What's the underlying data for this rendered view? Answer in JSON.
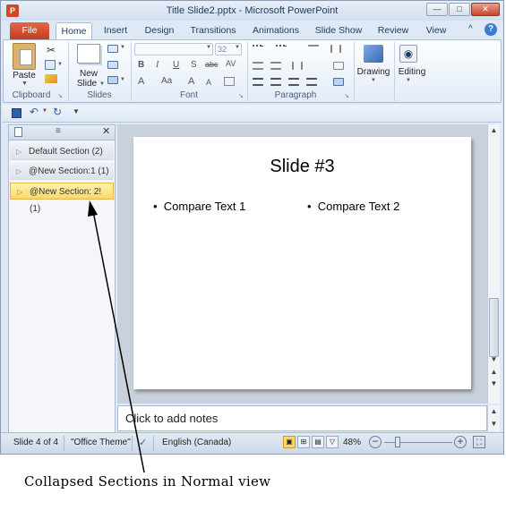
{
  "window": {
    "title": "Title Slide2.pptx - Microsoft PowerPoint",
    "app_icon": "P",
    "minimize_glyph": "—",
    "maximize_glyph": "□",
    "close_glyph": "✕"
  },
  "tabs": {
    "file": "File",
    "items": [
      "Home",
      "Insert",
      "Design",
      "Transitions",
      "Animations",
      "Slide Show",
      "Review",
      "View"
    ]
  },
  "ribbon": {
    "clipboard": {
      "paste": "Paste",
      "label": "Clipboard"
    },
    "slides": {
      "new_slide": "New",
      "new_slide_2": "Slide",
      "label": "Slides"
    },
    "font": {
      "size": "32",
      "label": "Font",
      "bold": "B",
      "italic": "I",
      "underline": "U",
      "shadow": "S",
      "strike": "abc",
      "spacing": "AV",
      "color": "A",
      "case": "Aa",
      "grow": "A",
      "shrink": "A"
    },
    "paragraph": {
      "label": "Paragraph"
    },
    "drawing": {
      "label": "Drawing"
    },
    "editing": {
      "label": "Editing"
    }
  },
  "sections": [
    {
      "label": "Default Section (2)"
    },
    {
      "label": "@New Section:1 (1)"
    },
    {
      "label": "@New Section: 2! (1)"
    }
  ],
  "slide": {
    "title": "Slide #3",
    "col1": "Compare Text 1",
    "col2": "Compare Text 2"
  },
  "notes": {
    "placeholder": "Click to add notes"
  },
  "status": {
    "slide": "Slide 4 of 4",
    "theme": "\"Office Theme\"",
    "language": "English (Canada)",
    "zoom": "48%"
  },
  "caption": "Collapsed Sections in Normal view"
}
